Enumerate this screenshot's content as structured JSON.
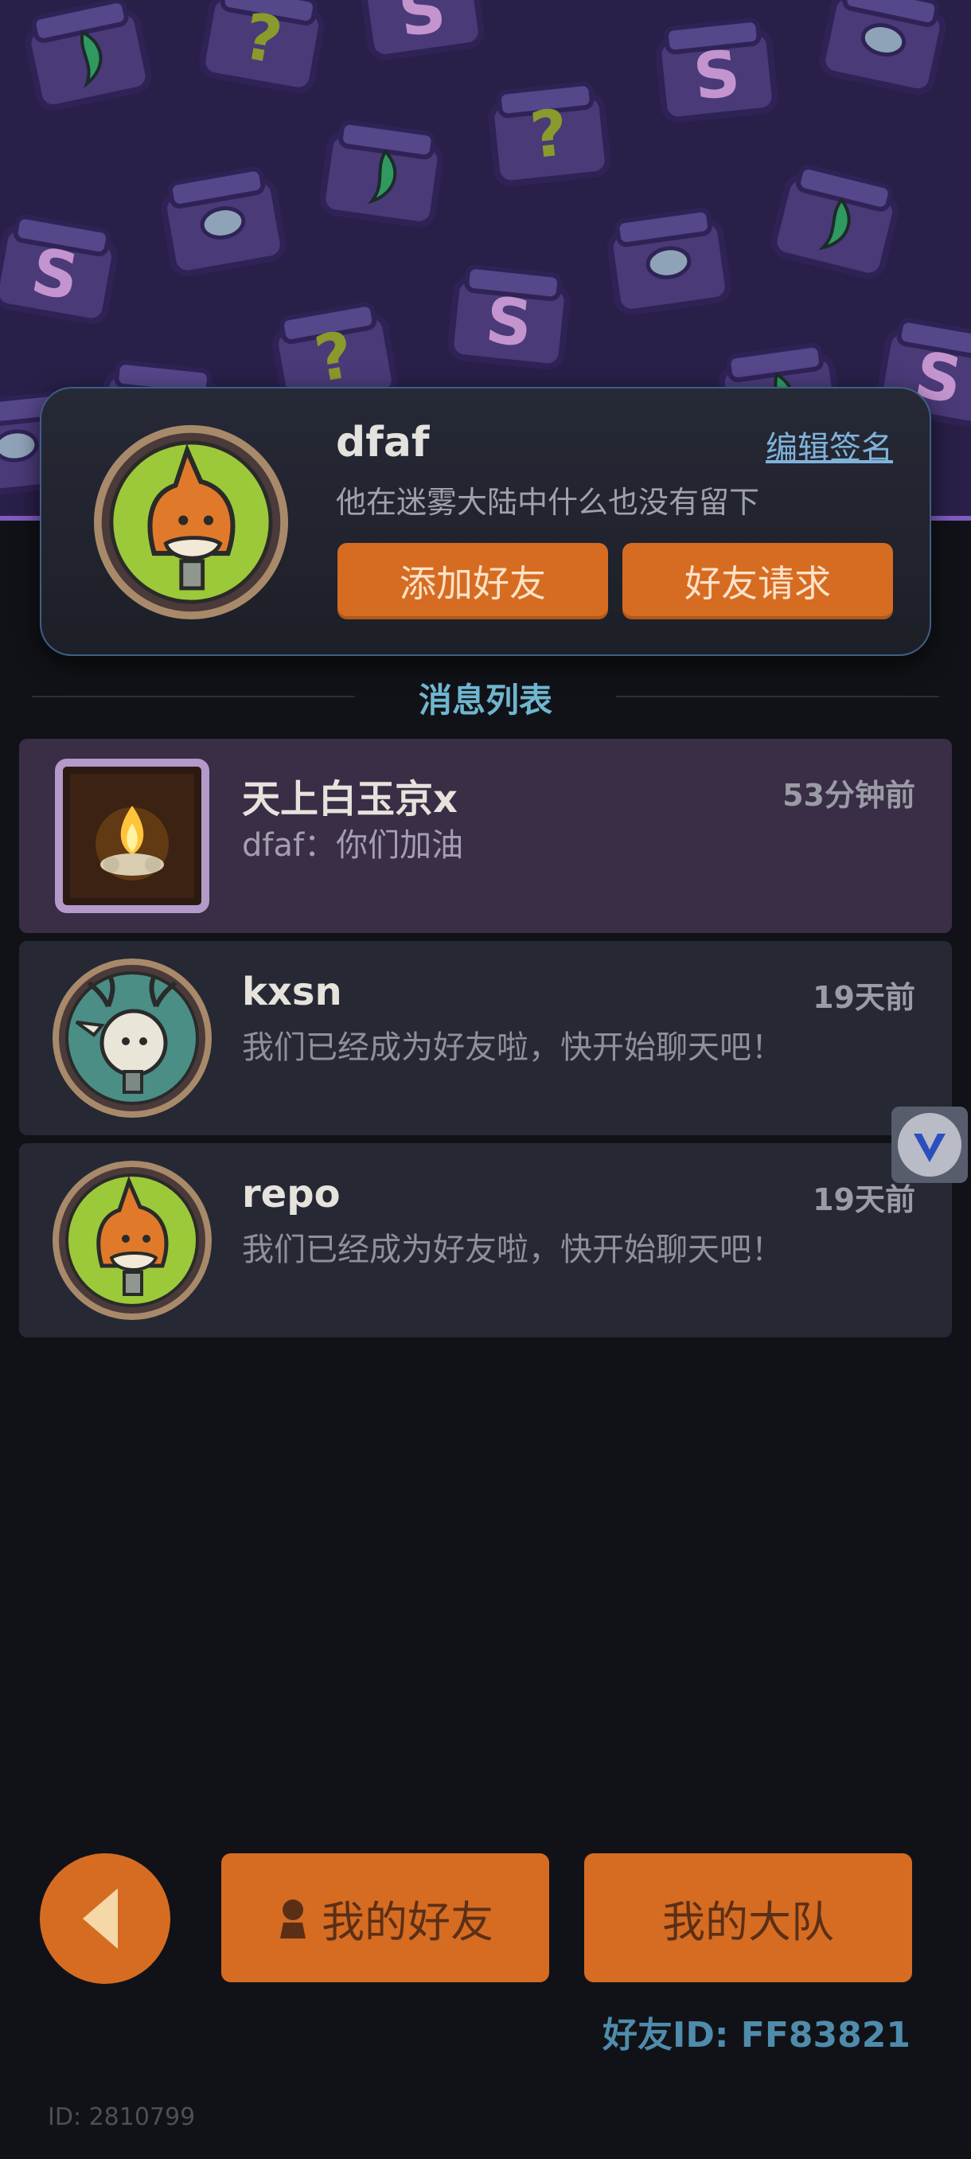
{
  "profile": {
    "username": "dfaf",
    "edit_signature": "编辑签名",
    "signature": "他在迷雾大陆中什么也没有留下",
    "add_friend": "添加好友",
    "friend_requests": "好友请求"
  },
  "section_title": "消息列表",
  "messages": [
    {
      "name": "天上白玉京x",
      "time": "53分钟前",
      "text": "dfaf：你们加油",
      "active": true
    },
    {
      "name": "kxsn",
      "time": "19天前",
      "text": "我们已经成为好友啦，快开始聊天吧！",
      "active": false
    },
    {
      "name": "repo",
      "time": "19天前",
      "text": "我们已经成为好友啦，快开始聊天吧！",
      "active": false
    }
  ],
  "bottom": {
    "my_friends": "我的好友",
    "my_team": "我的大队"
  },
  "footer": {
    "friend_id": "好友ID: FF83821",
    "player_id": "ID: 2810799"
  },
  "icons": {
    "back": "back-arrow-icon",
    "person": "person-icon",
    "widget": "v-logo-icon"
  },
  "colors": {
    "accent_orange": "#d66c22",
    "banner_purple": "#2a1f48",
    "link_blue": "#7fb2d9"
  }
}
